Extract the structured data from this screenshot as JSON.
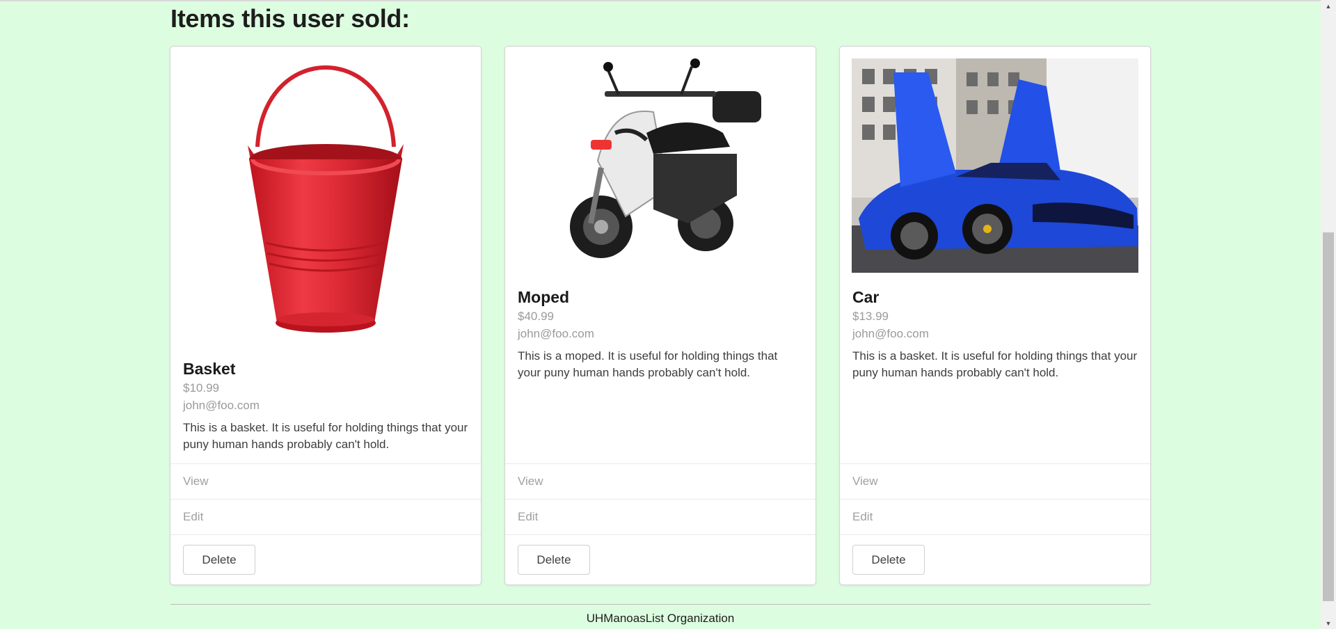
{
  "page": {
    "heading": "Items this user sold:",
    "footer": "UHManoasList Organization"
  },
  "items": [
    {
      "name": "Basket",
      "price": "$10.99",
      "owner": "john@foo.com",
      "description": "This is a basket. It is useful for holding things that your puny human hands probably can't hold.",
      "image": "red-bucket-image",
      "view_label": "View",
      "edit_label": "Edit",
      "delete_label": "Delete"
    },
    {
      "name": "Moped",
      "price": "$40.99",
      "owner": "john@foo.com",
      "description": "This is a moped. It is useful for holding things that your puny human hands probably can't hold.",
      "image": "moped-image",
      "view_label": "View",
      "edit_label": "Edit",
      "delete_label": "Delete"
    },
    {
      "name": "Car",
      "price": "$13.99",
      "owner": "john@foo.com",
      "description": "This is a basket. It is useful for holding things that your puny human hands probably can't hold.",
      "image": "blue-sports-car-image",
      "view_label": "View",
      "edit_label": "Edit",
      "delete_label": "Delete"
    }
  ],
  "colors": {
    "background": "#ddfde0",
    "card": "#ffffff",
    "muted_text": "#9a9a9a"
  }
}
